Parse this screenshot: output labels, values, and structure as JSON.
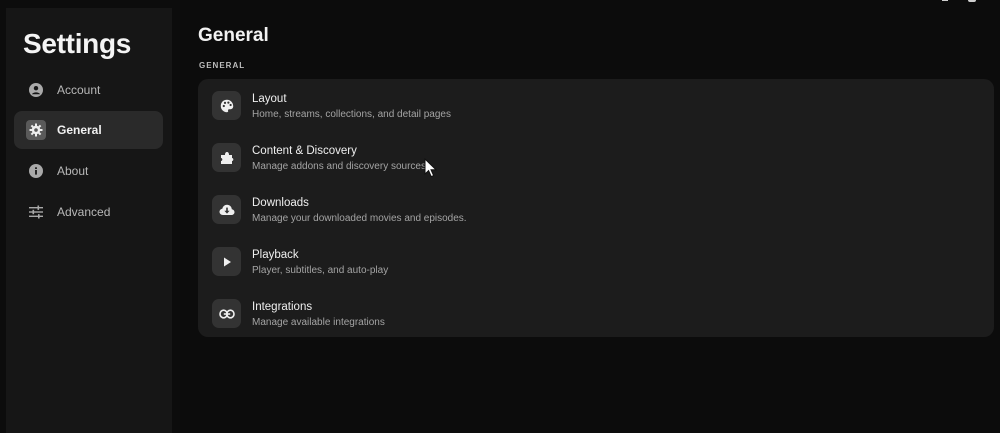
{
  "sidebar": {
    "title": "Settings",
    "items": [
      {
        "label": "Account",
        "icon": "account-circle-icon"
      },
      {
        "label": "General",
        "icon": "gear-icon",
        "active": true
      },
      {
        "label": "About",
        "icon": "info-icon"
      },
      {
        "label": "Advanced",
        "icon": "sliders-icon"
      }
    ]
  },
  "main": {
    "title": "General",
    "section_label": "GENERAL",
    "rows": [
      {
        "title": "Layout",
        "desc": "Home, streams, collections, and detail pages",
        "icon": "palette-icon"
      },
      {
        "title": "Content & Discovery",
        "desc": "Manage addons and discovery sources.",
        "icon": "puzzle-icon"
      },
      {
        "title": "Downloads",
        "desc": "Manage your downloaded movies and episodes.",
        "icon": "cloud-download-icon"
      },
      {
        "title": "Playback",
        "desc": "Player, subtitles, and auto-play",
        "icon": "play-icon"
      },
      {
        "title": "Integrations",
        "desc": "Manage available integrations",
        "icon": "link-icon"
      }
    ]
  },
  "colors": {
    "background": "#0c0c0c",
    "sidebar": "#161616",
    "panel": "#1c1c1c",
    "active_item": "#2a2a2a",
    "icon_tile": "#333333"
  }
}
